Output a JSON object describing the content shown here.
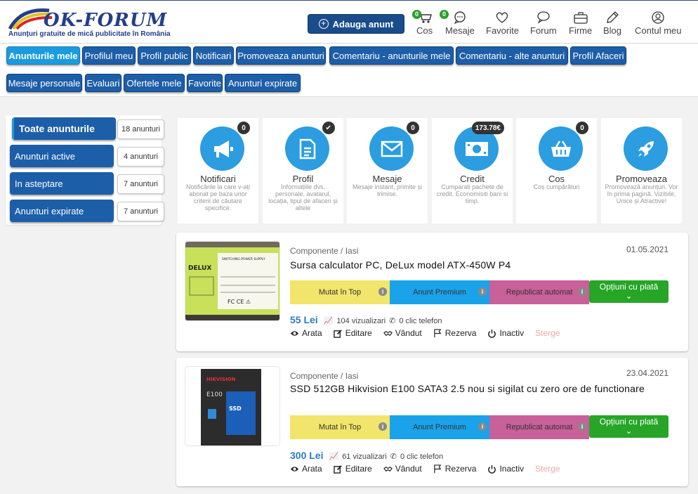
{
  "header": {
    "logo_text": "OK-FORUM",
    "logo_tagline": "Anunțuri gratuite de mică publicitate în România",
    "add_button": "Adauga anunt",
    "nav": [
      {
        "label": "Cos",
        "icon": "cart-icon",
        "badge": "0"
      },
      {
        "label": "Mesaje",
        "icon": "chat-icon",
        "badge": "0"
      },
      {
        "label": "Favorite",
        "icon": "heart-icon"
      },
      {
        "label": "Forum",
        "icon": "forum-icon"
      },
      {
        "label": "Firme",
        "icon": "briefcase-icon"
      },
      {
        "label": "Blog",
        "icon": "pencil-icon"
      },
      {
        "label": "Contul meu",
        "icon": "user-icon"
      }
    ]
  },
  "tabs": {
    "row1": [
      "Anunturile mele",
      "Profilul meu",
      "Profil public",
      "Notificari",
      "Promoveaza anunturi",
      "Comentariu - anunturile mele",
      "Comentariu - alte anunturi",
      "Profil Afaceri"
    ],
    "row2": [
      "Mesaje personale",
      "Evaluari",
      "Ofertele mele",
      "Favorite",
      "Anunturi expirate"
    ],
    "active": "Anunturile mele"
  },
  "filters": [
    {
      "label": "Toate anunturile",
      "count": "18 anunturi",
      "active": true
    },
    {
      "label": "Anunturi active",
      "count": "4 anunturi",
      "active": false
    },
    {
      "label": "In asteptare",
      "count": "7 anunturi",
      "active": false
    },
    {
      "label": "Anunturi expirate",
      "count": "7 anunturi",
      "active": false
    }
  ],
  "cards": [
    {
      "title": "Notificari",
      "desc": "Notificările la care v-ați abonat pe baza unor criterii de căutare specifice.",
      "badge": "0",
      "icon": "megaphone-icon"
    },
    {
      "title": "Profil",
      "desc": "Informațiile dvs. personale, avatarul, locația, tipul de afaceri și altele",
      "badge": "✔",
      "icon": "document-icon"
    },
    {
      "title": "Mesaje",
      "desc": "Mesaje instant, primite și trimise.",
      "badge": "0",
      "icon": "envelope-icon"
    },
    {
      "title": "Credit",
      "desc": "Cumparati pachete de credit. Economisiti bani si timp.",
      "badge": "173.78€",
      "icon": "money-icon"
    },
    {
      "title": "Cos",
      "desc": "Coș cumpărături",
      "badge": "0",
      "icon": "basket-icon"
    },
    {
      "title": "Promoveaza",
      "desc": "Promovează anunțuri. Vor în prima pagină. Vizibile, Unice și Atractive!",
      "icon": "rocket-icon"
    }
  ],
  "promo_labels": {
    "top": "Mutat în Top",
    "premium": "Anunt Premium",
    "republish": "Republicat automat",
    "options": "Opțiuni cu plată"
  },
  "action_labels": {
    "show": "Arata",
    "edit": "Editare",
    "sold": "Vândut",
    "reserve": "Rezerva",
    "inactive": "Inactiv",
    "delete": "Sterge"
  },
  "listings": [
    {
      "category": "Componente / Iasi",
      "date": "01.05.2021",
      "title": "Sursa calculator PC, DeLux model ATX-450W P4",
      "price": "55 Lei",
      "views": "104 vizualizari",
      "phone_clicks": "0 clic telefon",
      "image_brand": "DELUX",
      "image_text": "SWITCHING POWER SUPPLY"
    },
    {
      "category": "Componente / Iasi",
      "date": "23.04.2021",
      "title": "SSD 512GB Hikvision E100 SATA3 2.5 nou si sigilat cu zero ore de functionare",
      "price": "300 Lei",
      "views": "61 vizualizari",
      "phone_clicks": "0 clic telefon",
      "image_brand": "HIKVISION",
      "image_text": "E100"
    }
  ],
  "colors": {
    "brand_blue": "#1d5ea8",
    "active_blue": "#1a9be0",
    "icon_blue": "#2b9de0",
    "top_yellow": "#f2e56b",
    "premium_blue": "#1aa3ea",
    "republish_pink": "#c8609a",
    "options_green": "#26a526"
  }
}
